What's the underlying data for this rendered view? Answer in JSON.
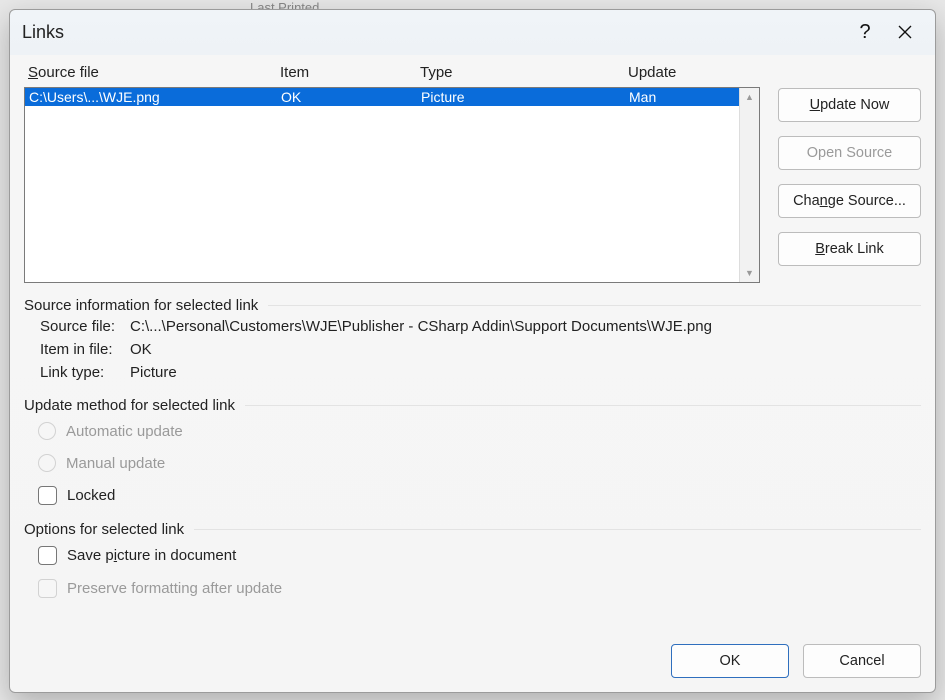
{
  "bg_text": "Last Printed",
  "title": "Links",
  "headers": {
    "source_pre": "S",
    "source_rest": "ource file",
    "item": "Item",
    "type": "Type",
    "update": "Update"
  },
  "rows": [
    {
      "source": "C:\\Users\\...\\WJE.png",
      "item": "OK",
      "type": "Picture",
      "update": "Man"
    }
  ],
  "side": {
    "update_pre": "U",
    "update_rest": "pdate Now",
    "open": "Open Source",
    "change_pre": "Cha",
    "change_u": "n",
    "change_rest": "ge Source...",
    "break_pre": "B",
    "break_rest": "reak Link"
  },
  "sections": {
    "info_title": "Source information for selected link",
    "update_title": "Update method for selected link",
    "options_title": "Options for selected link"
  },
  "info": {
    "source_label": "Source file:",
    "source_value": "C:\\...\\Personal\\Customers\\WJE\\Publisher - CSharp Addin\\Support Documents\\WJE.png",
    "item_label": "Item in file:",
    "item_value": "OK",
    "type_label": "Link type:",
    "type_value": "Picture"
  },
  "update_method": {
    "auto": "Automatic update",
    "manual": "Manual update",
    "locked": "Locked"
  },
  "options": {
    "save_pre": "Save p",
    "save_u": "i",
    "save_rest": "cture in document",
    "preserve": "Preserve formatting after update"
  },
  "footer": {
    "ok": "OK",
    "cancel": "Cancel"
  }
}
